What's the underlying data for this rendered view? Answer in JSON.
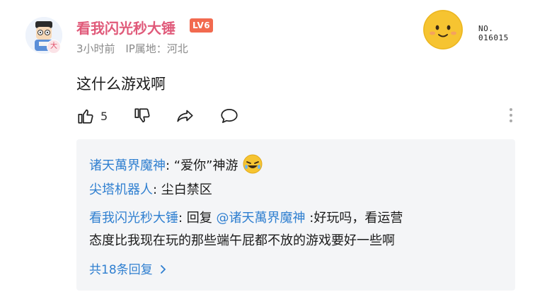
{
  "comment": {
    "username": "看我闪光秒大锤",
    "level": "LV6",
    "avatar_badge": "大",
    "time": "3小时前",
    "ip_location": "IP属地：河北",
    "text": "这什么游戏啊",
    "likes": "5",
    "fan_medal_number_line1": "NO.",
    "fan_medal_number_line2": "016015"
  },
  "replies": [
    {
      "name": "诸天萬界魔神",
      "sep": ": ",
      "text": "“爱你”神游"
    },
    {
      "name": "尖塔机器人",
      "sep": ": ",
      "text": "尘白禁区"
    },
    {
      "name": "看我闪光秒大锤",
      "sep": ": ",
      "prefix": "回复 ",
      "mention": "@诸天萬界魔神",
      "text": " :好玩吗，看运营",
      "text_line2": "态度比我现在玩的那些端午屁都不放的游戏要好一些啊"
    }
  ],
  "view_all_replies": "共18条回复",
  "icons": {
    "like": "thumbs-up-icon",
    "dislike": "thumbs-down-icon",
    "share": "share-icon",
    "reply": "comment-bubble-icon",
    "more": "more-vertical-icon",
    "chevron": "chevron-right-icon",
    "emoji": "laughing-emoji-icon"
  },
  "colors": {
    "username": "#e05a7a",
    "reply_name": "#2f7fd0",
    "level_badge": "#f26a4f",
    "reply_bg": "#f4f5f7"
  }
}
